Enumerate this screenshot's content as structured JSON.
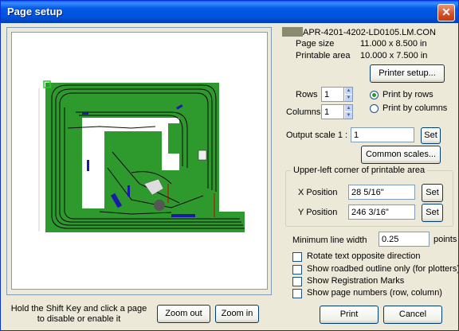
{
  "window": {
    "title": "Page setup"
  },
  "file": {
    "name": "APR-4201-4202-LD0105.LM.CON"
  },
  "page_size": {
    "label": "Page size",
    "value": "11.000 x 8.500 in"
  },
  "printable_area": {
    "label": "Printable area",
    "value": "10.000 x 7.500 in"
  },
  "buttons": {
    "printer_setup": "Printer setup...",
    "common_scales": "Common scales...",
    "zoom_out": "Zoom out",
    "zoom_in": "Zoom in",
    "print": "Print",
    "cancel": "Cancel"
  },
  "layout": {
    "rows_label": "Rows",
    "rows_value": "1",
    "columns_label": "Columns",
    "columns_value": "1",
    "print_by_rows": "Print by rows",
    "print_by_columns": "Print by columns",
    "selected_order": "rows"
  },
  "output_scale": {
    "label": "Output scale  1 :",
    "value": "1",
    "set_label": "Set"
  },
  "upper_left": {
    "title": "Upper-left corner of printable area",
    "x_label": "X Position",
    "x_value": "28 5/16\"",
    "y_label": "Y Position",
    "y_value": "246 3/16\"",
    "set_label": "Set"
  },
  "min_line_width": {
    "label": "Minimum line width",
    "value": "0.25",
    "unit": "points"
  },
  "options": [
    {
      "label": "Rotate text opposite direction",
      "checked": false
    },
    {
      "label": "Show roadbed outline only (for plotters)",
      "checked": false
    },
    {
      "label": "Show Registration Marks",
      "checked": false
    },
    {
      "label": "Show page numbers (row, column)",
      "checked": false
    }
  ],
  "hint": "Hold the Shift Key and click a page to disable or enable it",
  "colors": {
    "titlebar": "#0058e6",
    "layout_green": "#2e9a2e",
    "background": "#ece9d8"
  }
}
